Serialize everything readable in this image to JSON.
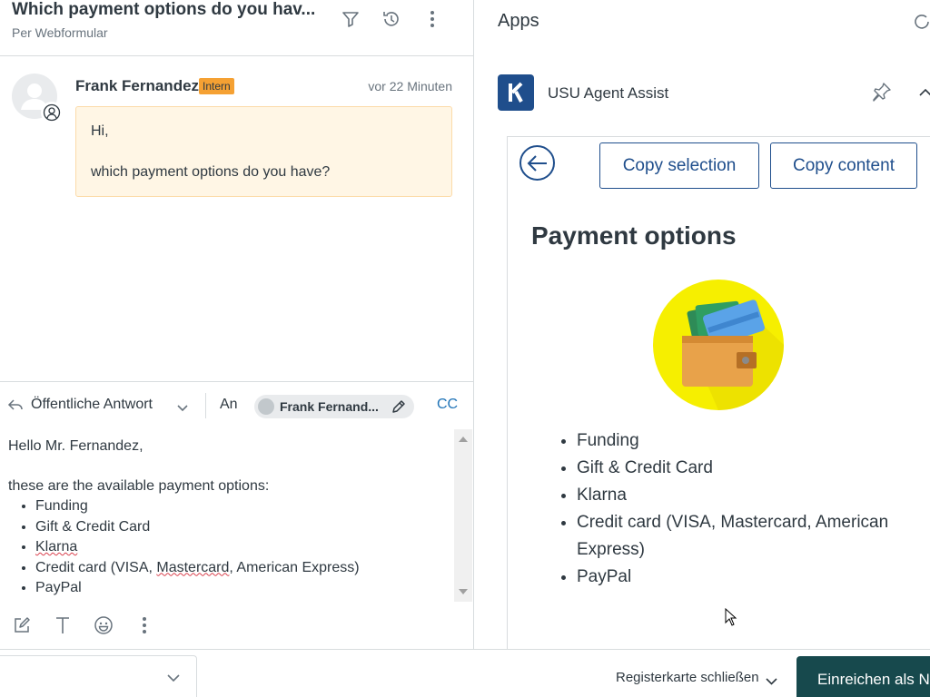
{
  "ticket": {
    "title": "Which payment options do you hav...",
    "subtitle": "Per Webformular"
  },
  "message": {
    "sender": "Frank Fernandez",
    "badge": "Intern",
    "time": "vor 22 Minuten",
    "lines": [
      "Hi,",
      "which payment options do you have?"
    ]
  },
  "composer": {
    "reply_type": "Öffentliche Antwort",
    "to_label": "An",
    "recipient": "Frank Fernand...",
    "cc_label": "CC",
    "greeting": "Hello Mr. Fernandez,",
    "intro": "these are the available payment options:",
    "items": [
      "Funding",
      "Gift & Credit Card",
      "Klarna",
      "Credit card (VISA, ",
      "Mastercard",
      ", American Express)",
      "PayPal"
    ]
  },
  "apps": {
    "title": "Apps",
    "app_name": "USU Agent Assist",
    "copy_selection": "Copy selection",
    "copy_content": "Copy content",
    "article_title": "Payment options",
    "article_items": [
      "Funding",
      "Gift & Credit Card",
      "Klarna",
      "Credit card (VISA, Mastercard, American Express)",
      "PayPal"
    ]
  },
  "footer": {
    "close_tab": "Registerkarte schließen",
    "submit": "Einreichen als N"
  },
  "colors": {
    "brand": "#1f4e8c",
    "submit_bg": "#17494d",
    "intern_badge": "#f5a133",
    "bubble_bg": "#fff6e5",
    "link": "#1f73b7"
  }
}
